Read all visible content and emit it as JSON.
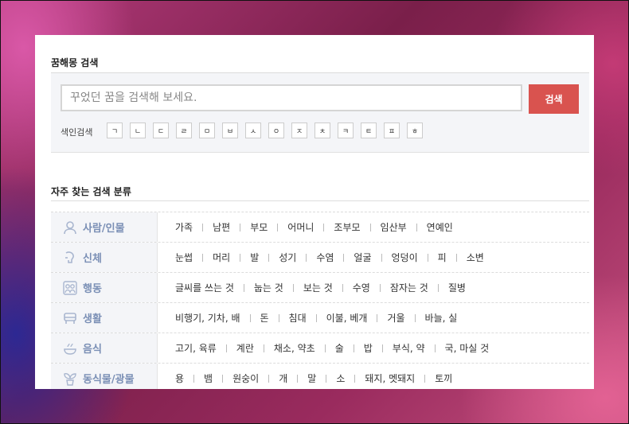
{
  "search_section": {
    "title": "꿈해몽 검색",
    "placeholder": "꾸었던 꿈을 검색해 보세요.",
    "button_label": "검색",
    "index_label": "색인검색",
    "index_keys": [
      "ㄱ",
      "ㄴ",
      "ㄷ",
      "ㄹ",
      "ㅁ",
      "ㅂ",
      "ㅅ",
      "ㅇ",
      "ㅈ",
      "ㅊ",
      "ㅋ",
      "ㅌ",
      "ㅍ",
      "ㅎ"
    ]
  },
  "category_section": {
    "title": "자주 찾는 검색 분류",
    "categories": [
      {
        "name": "사람/인물",
        "icon": "person-icon",
        "items": [
          "가족",
          "남편",
          "부모",
          "어머니",
          "조부모",
          "임산부",
          "연예인"
        ]
      },
      {
        "name": "신체",
        "icon": "body-icon",
        "items": [
          "눈썹",
          "머리",
          "발",
          "성기",
          "수염",
          "얼굴",
          "엉덩이",
          "피",
          "소변"
        ]
      },
      {
        "name": "행동",
        "icon": "people-icon",
        "items": [
          "글씨를 쓰는 것",
          "눕는 것",
          "보는 것",
          "수영",
          "잠자는 것",
          "질병"
        ]
      },
      {
        "name": "생활",
        "icon": "car-icon",
        "items": [
          "비행기, 기차, 배",
          "돈",
          "침대",
          "이불, 베개",
          "거울",
          "바늘, 실"
        ]
      },
      {
        "name": "음식",
        "icon": "food-icon",
        "items": [
          "고기, 육류",
          "계란",
          "채소, 약초",
          "술",
          "밥",
          "부식, 약",
          "국, 마실 것"
        ]
      },
      {
        "name": "동식물/광물",
        "icon": "plant-icon",
        "items": [
          "용",
          "뱀",
          "원숭이",
          "개",
          "말",
          "소",
          "돼지, 멧돼지",
          "토끼"
        ]
      }
    ]
  },
  "colors": {
    "accent": "#d9534f",
    "category_text": "#7a8fb5",
    "panel_bg": "#f4f5f8"
  }
}
